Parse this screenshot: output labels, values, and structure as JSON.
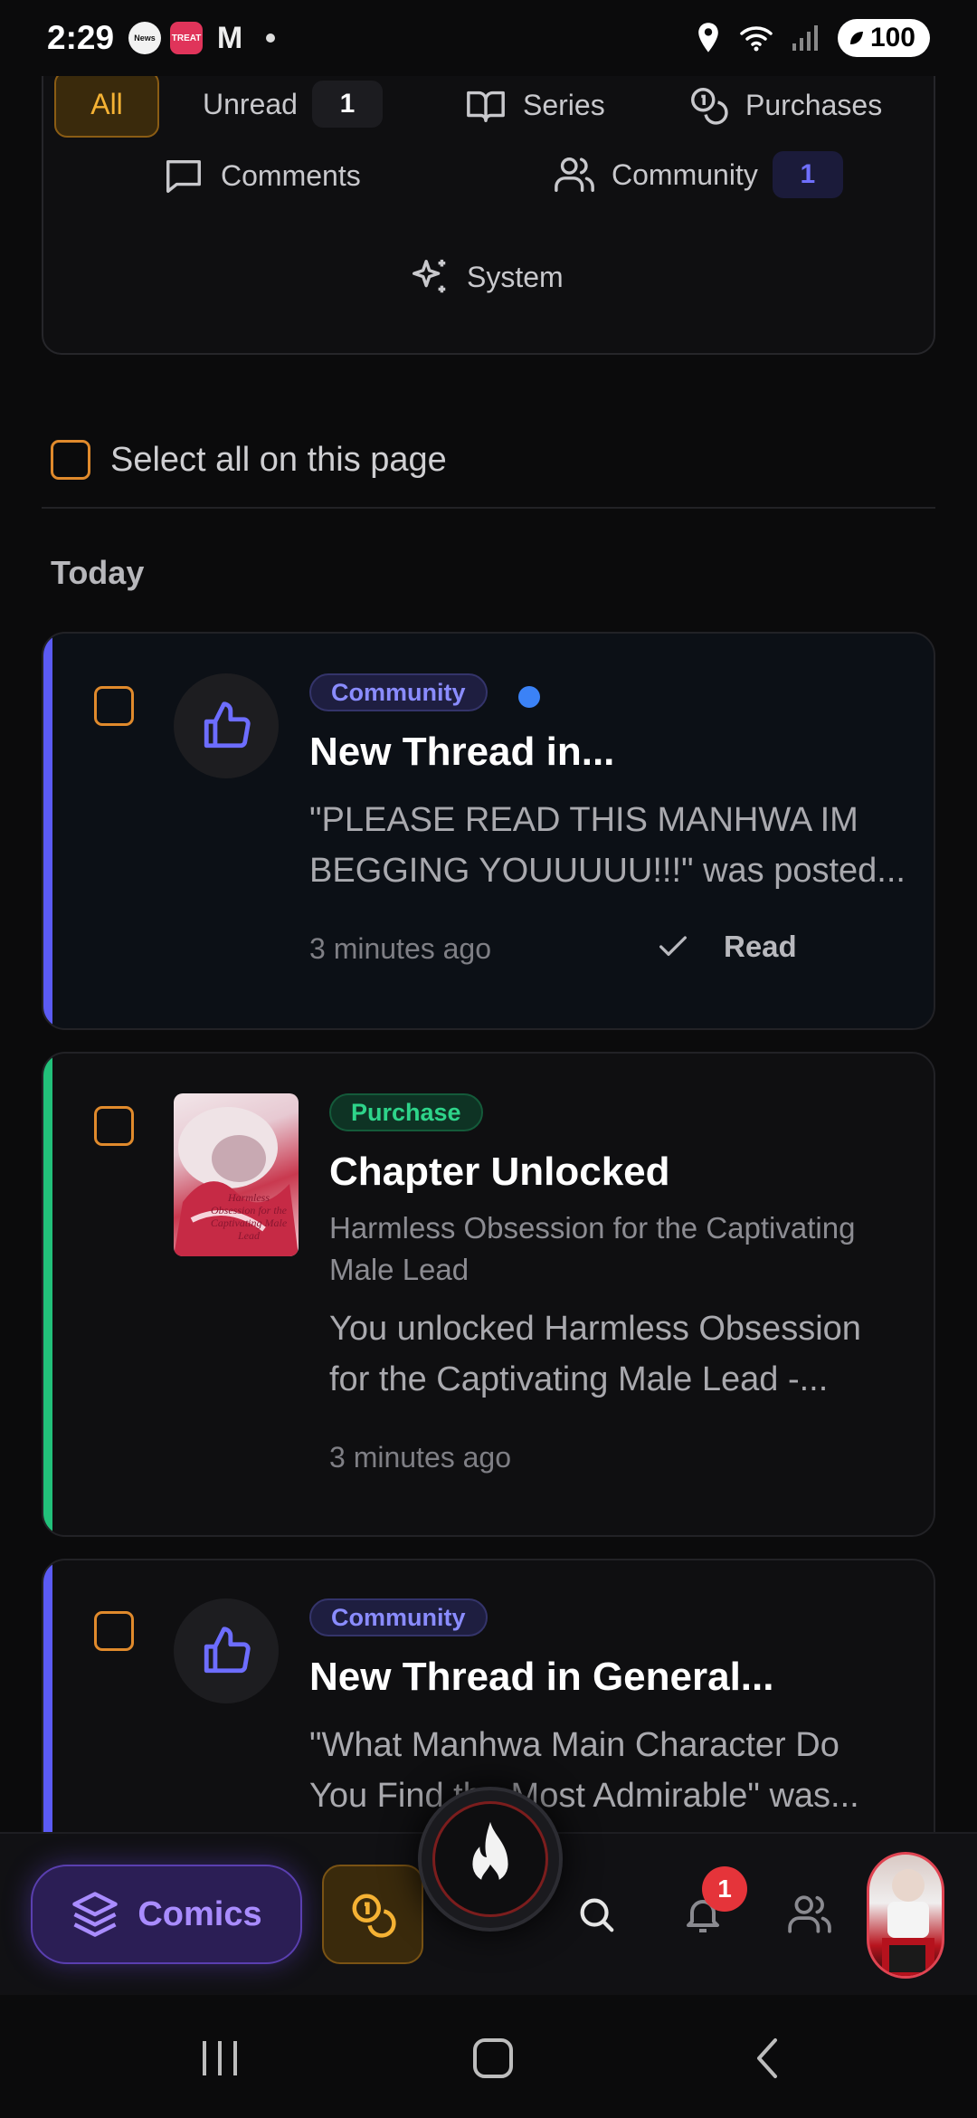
{
  "status_bar": {
    "time": "2:29",
    "notif_news": "News",
    "notif_app": "TREAT",
    "battery": "100"
  },
  "filters": {
    "all": "All",
    "unread": "Unread",
    "unread_count": "1",
    "series": "Series",
    "purchases": "Purchases",
    "comments": "Comments",
    "community": "Community",
    "community_count": "1",
    "system": "System"
  },
  "select_all_label": "Select all on this page",
  "section_today": "Today",
  "notifications": [
    {
      "tag": "Community",
      "title": "New Thread in...",
      "body_line1": "\"PLEASE READ THIS MANHWA IM",
      "body_line2": "BEGGING YOUUUUU!!!\" was posted...",
      "time": "3 minutes ago",
      "read_label": "Read",
      "accent": "#5b5bf5"
    },
    {
      "tag": "Purchase",
      "title": "Chapter Unlocked",
      "series_line1": "Harmless Obsession for the Captivating",
      "series_line2": "Male Lead",
      "cover_title": "Harmless Obsession for the Captivating Male Lead",
      "body_line1": "You unlocked Harmless Obsession",
      "body_line2": "for the Captivating Male Lead -...",
      "time": "3 minutes ago",
      "accent": "#22c07a"
    },
    {
      "tag": "Community",
      "title": "New Thread in General...",
      "body_line1": "\"What Manhwa Main Character Do",
      "body_line2": "You Find the Most Admirable\" was...",
      "accent": "#5b5bf5"
    }
  ],
  "bottom_nav": {
    "comics_label": "Comics",
    "notification_count": "1"
  },
  "colors": {
    "background": "#0b0b0c",
    "accent_orange": "#f5b234",
    "accent_purple": "#8a8cff",
    "accent_green": "#2ed48a"
  }
}
